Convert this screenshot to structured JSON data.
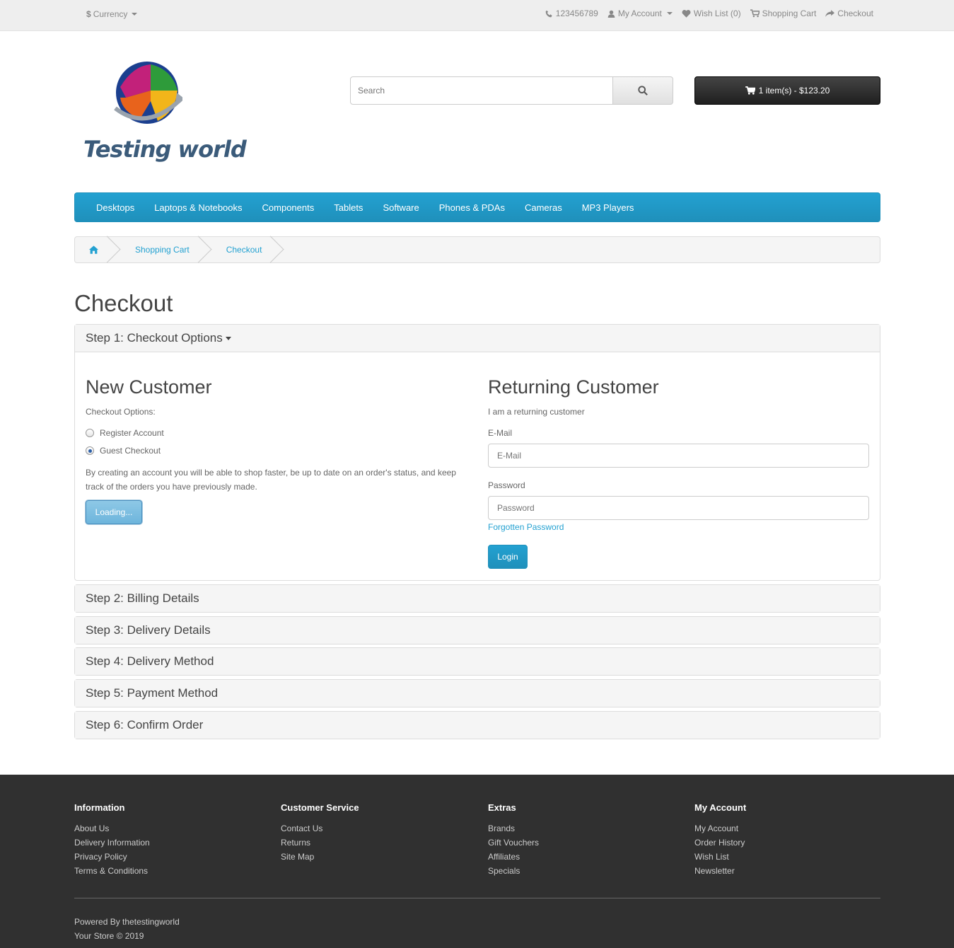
{
  "topbar": {
    "currency": "Currency",
    "currency_symbol": "$",
    "phone": "123456789",
    "my_account": "My Account",
    "wish_list": "Wish List (0)",
    "shopping_cart": "Shopping Cart",
    "checkout": "Checkout"
  },
  "header": {
    "logo_text": "Testing world",
    "search_placeholder": "Search",
    "cart_summary": "1 item(s) - $123.20"
  },
  "menu": [
    "Desktops",
    "Laptops & Notebooks",
    "Components",
    "Tablets",
    "Software",
    "Phones & PDAs",
    "Cameras",
    "MP3 Players"
  ],
  "breadcrumb": [
    "Shopping Cart",
    "Checkout"
  ],
  "page_title": "Checkout",
  "step1": {
    "title": "Step 1: Checkout Options",
    "new_customer": {
      "heading": "New Customer",
      "options_label": "Checkout Options:",
      "option_register": "Register Account",
      "option_guest": "Guest Checkout",
      "selected": "Guest Checkout",
      "description": "By creating an account you will be able to shop faster, be up to date on an order's status, and keep track of the orders you have previously made.",
      "button": "Loading..."
    },
    "returning_customer": {
      "heading": "Returning Customer",
      "subtext": "I am a returning customer",
      "email_label": "E-Mail",
      "email_placeholder": "E-Mail",
      "password_label": "Password",
      "password_placeholder": "Password",
      "forgotten": "Forgotten Password",
      "login_button": "Login"
    }
  },
  "steps": [
    "Step 2: Billing Details",
    "Step 3: Delivery Details",
    "Step 4: Delivery Method",
    "Step 5: Payment Method",
    "Step 6: Confirm Order"
  ],
  "footer": {
    "information": {
      "title": "Information",
      "links": [
        "About Us",
        "Delivery Information",
        "Privacy Policy",
        "Terms & Conditions"
      ]
    },
    "customer_service": {
      "title": "Customer Service",
      "links": [
        "Contact Us",
        "Returns",
        "Site Map"
      ]
    },
    "extras": {
      "title": "Extras",
      "links": [
        "Brands",
        "Gift Vouchers",
        "Affiliates",
        "Specials"
      ]
    },
    "my_account": {
      "title": "My Account",
      "links": [
        "My Account",
        "Order History",
        "Wish List",
        "Newsletter"
      ]
    },
    "powered_by": "Powered By",
    "powered_link": "thetestingworld",
    "copyright": "Your Store © 2019"
  },
  "colors": {
    "accent": "#23a1d1",
    "footer_bg": "#303030",
    "cart_button": "#222222"
  }
}
